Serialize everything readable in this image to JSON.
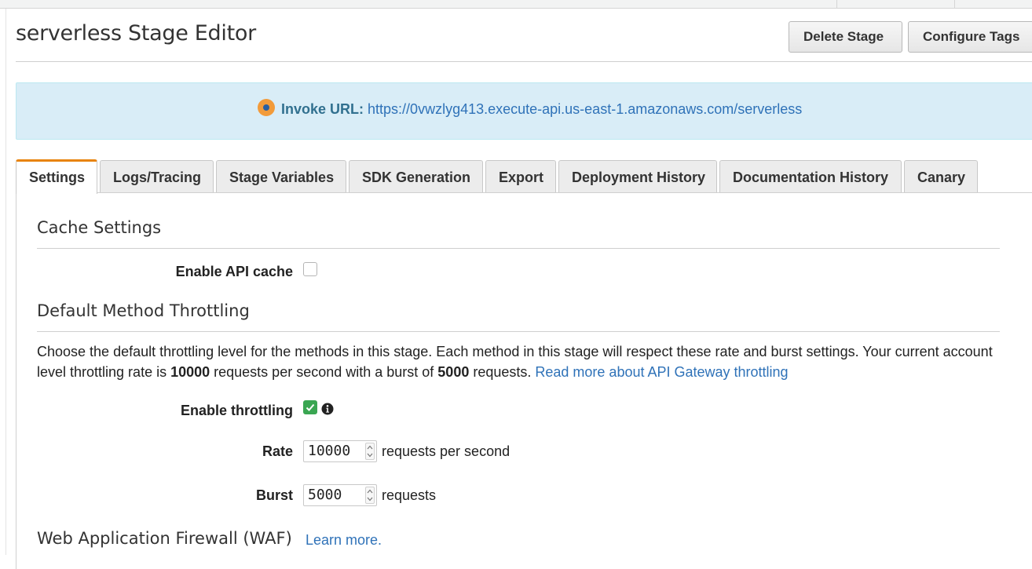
{
  "header": {
    "title": "serverless Stage Editor",
    "delete_button": "Delete Stage",
    "configure_button": "Configure Tags"
  },
  "invoke": {
    "label": "Invoke URL:",
    "url": "https://0vwzlyg413.execute-api.us-east-1.amazonaws.com/serverless",
    "status_color": "#f29b3a"
  },
  "tabs": [
    {
      "label": "Settings",
      "active": true
    },
    {
      "label": "Logs/Tracing",
      "active": false
    },
    {
      "label": "Stage Variables",
      "active": false
    },
    {
      "label": "SDK Generation",
      "active": false
    },
    {
      "label": "Export",
      "active": false
    },
    {
      "label": "Deployment History",
      "active": false
    },
    {
      "label": "Documentation History",
      "active": false
    },
    {
      "label": "Canary",
      "active": false
    }
  ],
  "cache": {
    "section_title": "Cache Settings",
    "enable_label": "Enable API cache",
    "enabled": false
  },
  "throttling": {
    "section_title": "Default Method Throttling",
    "desc_part1": "Choose the default throttling level for the methods in this stage. Each method in this stage will respect these rate and burst settings. Your current account level throttling rate is ",
    "account_rate": "10000",
    "desc_part2": " requests per second with a burst of ",
    "account_burst": "5000",
    "desc_part3": " requests. ",
    "read_more_link": "Read more about API Gateway throttling",
    "enable_label": "Enable throttling",
    "enabled": true,
    "info_icon": "info-circle-icon",
    "rate_label": "Rate",
    "rate_value": "10000",
    "rate_unit": "requests per second",
    "burst_label": "Burst",
    "burst_value": "5000",
    "burst_unit": "requests"
  },
  "waf": {
    "section_title": "Web Application Firewall (WAF)",
    "learn_more": "Learn more."
  },
  "colors": {
    "accent_tab": "#e8830c",
    "link": "#2f72b8",
    "info_bg": "#d9edf7",
    "check_green": "#3aa652"
  }
}
